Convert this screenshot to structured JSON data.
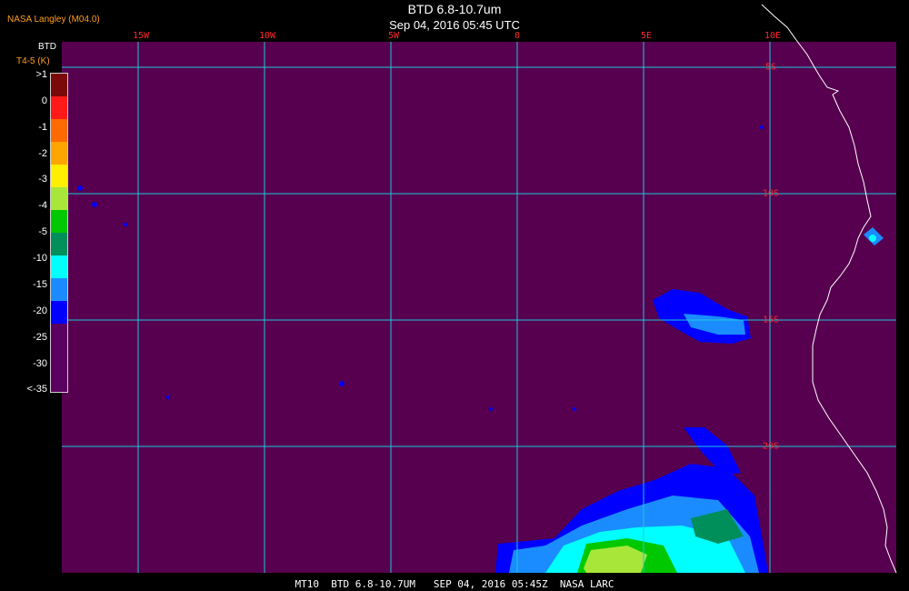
{
  "header": {
    "org": "NASA Langley (M04.0)",
    "title": "BTD 6.8-10.7um",
    "datetime": "Sep 04, 2016 05:45 UTC"
  },
  "legend": {
    "title": "BTD",
    "unit": "T4-5 (K)",
    "labels": [
      ">1",
      "0",
      "-1",
      "-2",
      "-3",
      "-4",
      "-5",
      "-10",
      "-15",
      "-20",
      "-25",
      "-30",
      "<-35"
    ],
    "colors": [
      "#7a0a0a",
      "#ff1a1a",
      "#ff6a00",
      "#ffa500",
      "#ffee00",
      "#a8e63a",
      "#00c800",
      "#008f5a",
      "#00ffff",
      "#1a8cff",
      "#0000ff",
      "#5a0060"
    ]
  },
  "map": {
    "background": "#56004f",
    "grid_color": "#1fc8d8",
    "lon_labels": [
      "15W",
      "10W",
      "5W",
      "0",
      "5E",
      "10E"
    ],
    "lat_labels": [
      "5S",
      "10S",
      "15S",
      "20S"
    ],
    "coast_color": "#ffffff"
  },
  "footer": {
    "text": "MT10  BTD 6.8-10.7UM   SEP 04, 2016 05:45Z  NASA LARC"
  }
}
